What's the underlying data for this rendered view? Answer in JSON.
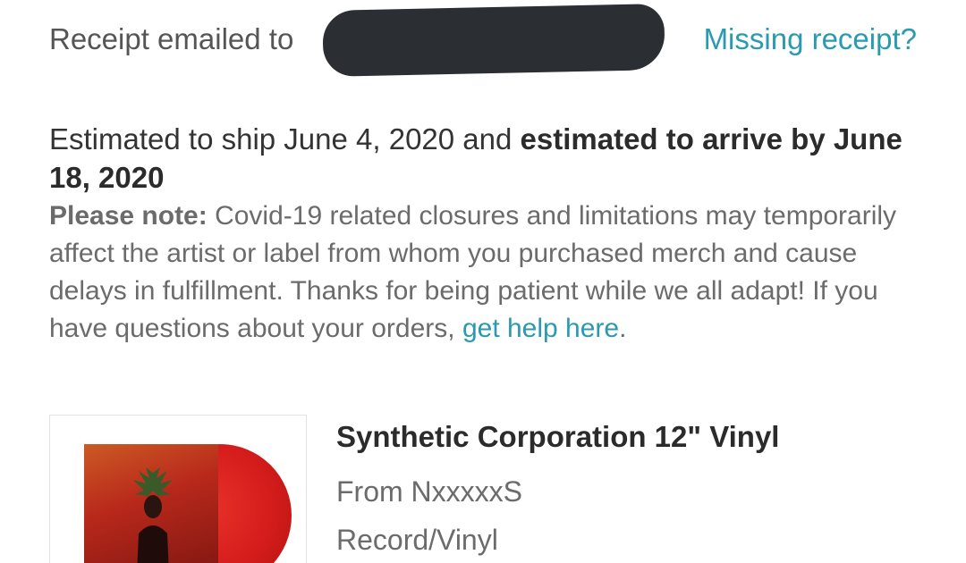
{
  "receipt": {
    "label": "Receipt emailed to",
    "missing_link": "Missing receipt?"
  },
  "shipping": {
    "estimate_prefix": "Estimated to ship June 4, 2020 and ",
    "estimate_bold": "estimated to arrive by June 18, 2020",
    "note_label": "Please note:",
    "note_text": " Covid-19 related closures and limitations may temporarily affect the artist or label from whom you purchased merch and cause delays in fulfillment. Thanks for being patient while we all adapt! If you have questions about your orders, ",
    "help_link": "get help here",
    "note_end": "."
  },
  "item": {
    "title": "Synthetic Corporation 12\" Vinyl",
    "from": "From NxxxxxS",
    "format": "Record/Vinyl"
  },
  "colors": {
    "link": "#2a9ab1",
    "redaction": "#2b2f33",
    "vinyl_red": "#d51d1c"
  }
}
